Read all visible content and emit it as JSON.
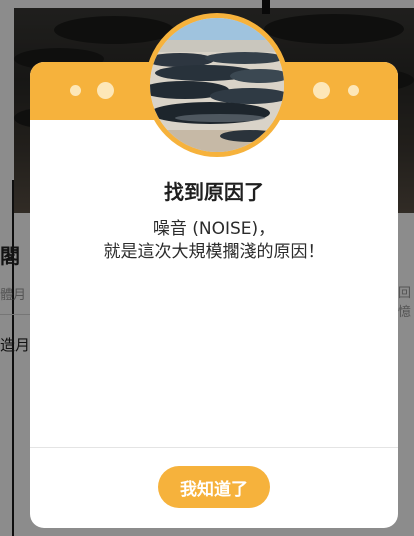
{
  "background": {
    "heading_fragment": "閣",
    "subtitle_fragment": "體月",
    "right_fragment": "回憶",
    "body_fragment": "造月"
  },
  "modal": {
    "title": "找到原因了",
    "message_line1": "噪音 (NOISE)，",
    "message_line2": "就是這次大規模擱淺的原因！",
    "ok_label": "我知道了",
    "colors": {
      "accent": "#f6b23c",
      "dot": "#fde7b8"
    },
    "avatar_image": "stranded-whales-photo"
  }
}
